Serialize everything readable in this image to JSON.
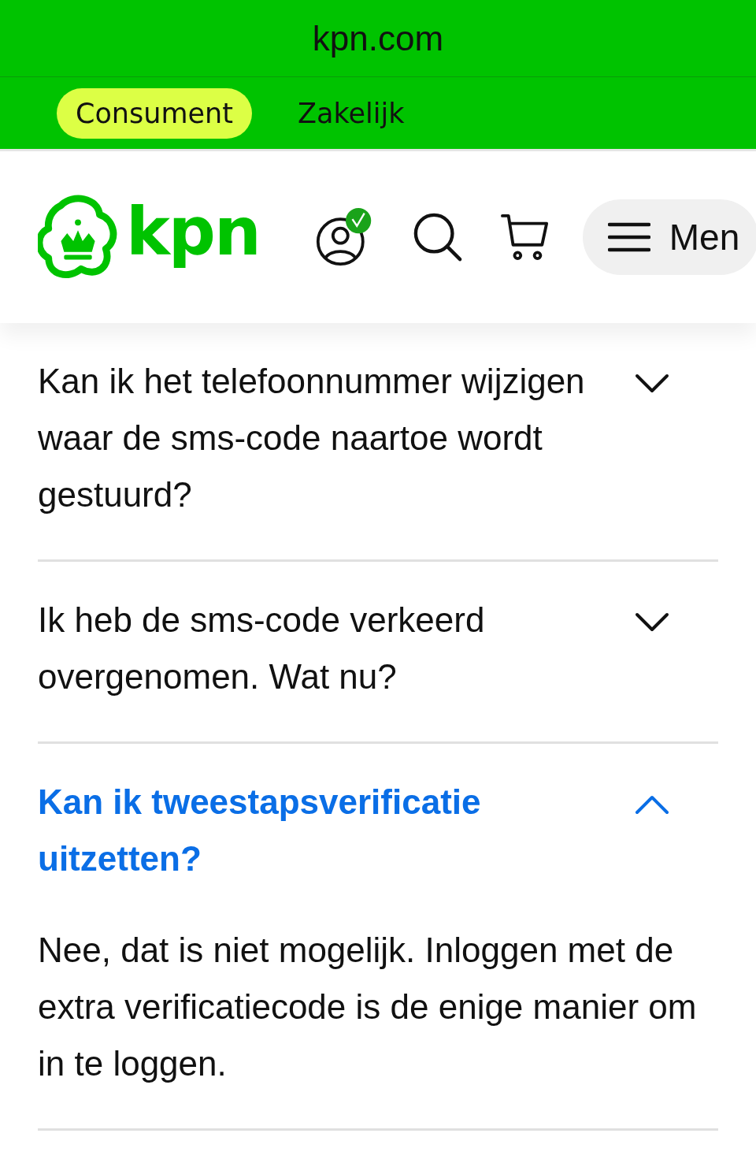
{
  "browser": {
    "url": "kpn.com"
  },
  "segments": [
    {
      "label": "Consument",
      "selected": true
    },
    {
      "label": "Zakelijk",
      "selected": false
    }
  ],
  "header": {
    "logo_text": "kpn",
    "account_verified": true,
    "menu_label": "Men"
  },
  "faq": [
    {
      "question": "Kan ik het telefoonnummer wijzigen waar de sms-code naartoe wordt gestuurd?",
      "expanded": false
    },
    {
      "question": "Ik heb de sms-code verkeerd overgenomen. Wat nu?",
      "expanded": false
    },
    {
      "question": "Kan ik tweestapsverificatie uitzetten?",
      "expanded": true,
      "answer": "Nee, dat is niet mogelijk. Inloggen met de extra verificatiecode is de enige manier om in te loggen."
    }
  ]
}
